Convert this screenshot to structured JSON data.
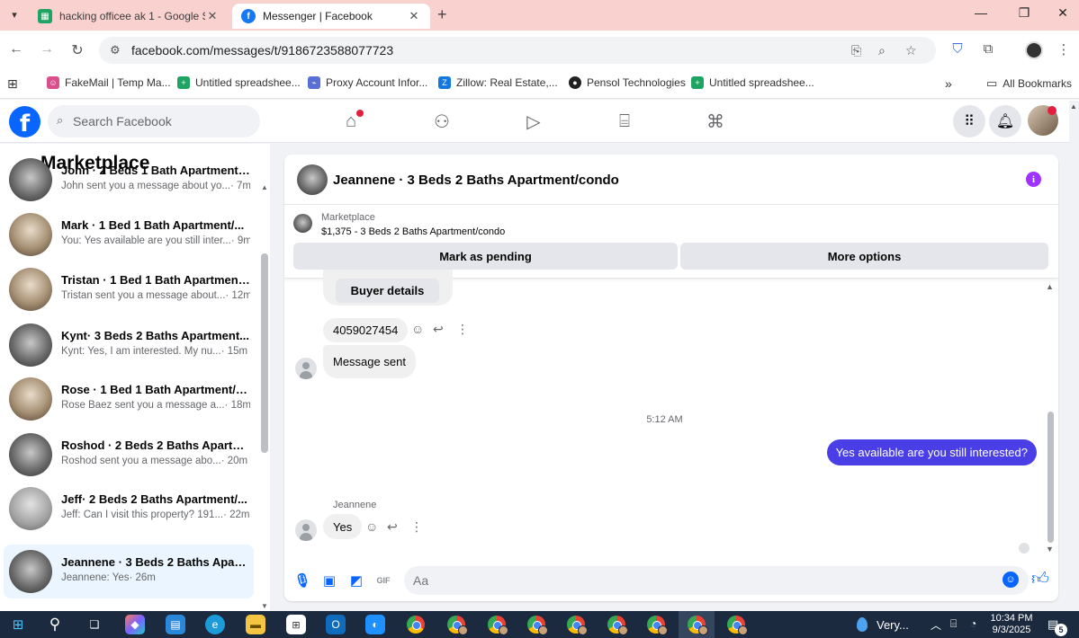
{
  "browser": {
    "tabs": [
      {
        "title": "hacking officee ak 1 - Google S",
        "favicon": "sheets-icon"
      },
      {
        "title": "Messenger | Facebook",
        "favicon": "facebook-icon",
        "active": true
      }
    ],
    "url": "facebook.com/messages/t/9186723588077723",
    "bookmarks": [
      {
        "label": "FakeMail | Temp Ma..."
      },
      {
        "label": "Untitled spreadshee..."
      },
      {
        "label": "Proxy Account Infor..."
      },
      {
        "label": "Zillow: Real Estate,..."
      },
      {
        "label": "Pensol Technologies"
      },
      {
        "label": "Untitled spreadshee..."
      }
    ],
    "all_bookmarks": "All Bookmarks"
  },
  "facebook": {
    "logo": "f",
    "search_placeholder": "Search Facebook",
    "accent_color": "#0866ff"
  },
  "sidebar": {
    "title": "Marketplace",
    "conversations": [
      {
        "name": "John · 2 Beds 1 Bath Apartment/...",
        "preview": "John sent you a message about yo...",
        "time": "· 7m"
      },
      {
        "name": "Mark · 1 Bed 1 Bath Apartment/...",
        "preview": "You: Yes available are you still inter...",
        "time": "· 9m"
      },
      {
        "name": "Tristan · 1 Bed 1 Bath Apartment...",
        "preview": "Tristan sent you a message about...",
        "time": "· 12m"
      },
      {
        "name": "Kynt· 3 Beds 2 Baths Apartment...",
        "preview": "Kynt: Yes, I am interested. My nu...",
        "time": "· 15m"
      },
      {
        "name": "Rose · 1 Bed 1 Bath Apartment/c...",
        "preview": "Rose Baez sent you a message a...",
        "time": "· 18m"
      },
      {
        "name": "Roshod · 2 Beds 2 Baths Apartm...",
        "preview": "Roshod sent you a message abo...",
        "time": "· 20m"
      },
      {
        "name": "Jeff· 2 Beds 2 Baths Apartment/...",
        "preview": "Jeff: Can I visit this property? 191...",
        "time": "· 22m"
      },
      {
        "name": "Jeannene · 3 Beds 2 Baths Apart...",
        "preview": "Jeannene: Yes",
        "time": "· 26m",
        "active": true
      }
    ]
  },
  "chat": {
    "title": "Jeannene · 3 Beds 2 Baths Apartment/condo",
    "info_icon": "i",
    "listing_label": "Marketplace",
    "listing_price": "$1,375 - 3 Beds 2 Baths Apartment/condo",
    "mark_pending": "Mark as pending",
    "more_options": "More options",
    "buyer_details": "Buyer details",
    "phone_message": "4059027454",
    "message_sent": "Message sent",
    "timestamp": "5:12 AM",
    "outgoing_message": "Yes available are you still  interested?",
    "sender_name": "Jeannene",
    "incoming_reply": "Yes",
    "composer_placeholder": "Aa",
    "outgoing_color": "#4a3ee6"
  },
  "taskbar": {
    "weather": "Very...",
    "time": "10:34 PM",
    "date": "9/3/2025",
    "notification_count": "5"
  }
}
